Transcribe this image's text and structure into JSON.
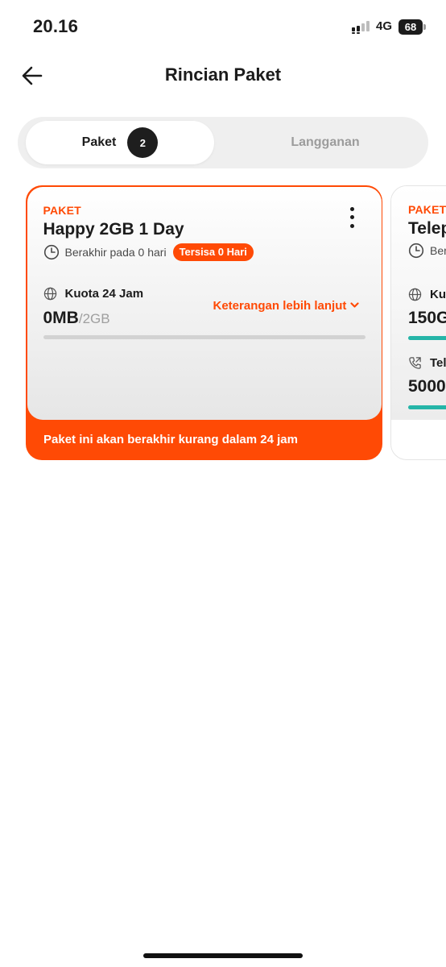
{
  "status_bar": {
    "time": "20.16",
    "network": "4G",
    "battery": "68",
    "icons": [
      "signal-icon",
      "battery-icon"
    ]
  },
  "header": {
    "title": "Rincian Paket",
    "back_icon": "back-arrow-icon"
  },
  "tabs": [
    {
      "label": "Paket",
      "badge": "2",
      "active": true
    },
    {
      "label": "Langganan",
      "active": false
    }
  ],
  "packages": [
    {
      "kind": "PAKET",
      "name": "Happy 2GB 1 Day",
      "expiry": "Berakhir pada 0 hari",
      "remaining_badge": "Tersisa 0 Hari",
      "quota_label": "Kuota 24 Jam",
      "used": "0MB",
      "total": "/2GB",
      "usage_fraction": 0,
      "more_info": "Keterangan lebih lanjut",
      "footer": "Paket ini akan berakhir kurang dalam 24 jam"
    },
    {
      "kind": "PAKET",
      "name": "Telep",
      "expiry": "Ber",
      "row1_label": "Kuo",
      "row1_value": "150G",
      "row2_label": "Tel",
      "row2_value": "5000"
    }
  ],
  "colors": {
    "accent": "#ff4a05",
    "progress": "#25b5a8",
    "tab_bg": "#efefef",
    "badge": "#1e1e1e"
  }
}
